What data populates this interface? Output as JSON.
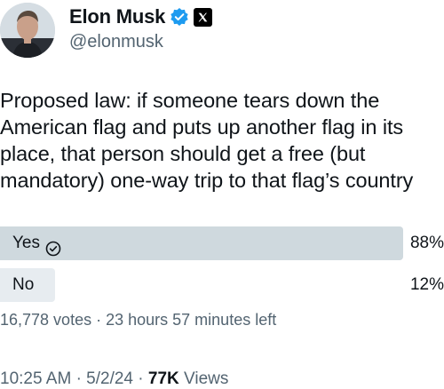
{
  "author": {
    "display_name": "Elon Musk",
    "handle": "@elonmusk",
    "verified_icon": "verified-badge-icon",
    "affiliate_icon": "x-logo-icon",
    "verified_color": "#1d9bf0"
  },
  "tweet": {
    "text": "Proposed law: if someone tears down the American flag and puts up another flag in its place, that person should get a free (but mandatory) one-way trip to that flag’s country"
  },
  "poll": {
    "options": [
      {
        "label": "Yes",
        "percent": "88%",
        "fraction": 0.88,
        "selected": true
      },
      {
        "label": "No",
        "percent": "12%",
        "fraction": 0.12,
        "selected": false
      }
    ],
    "votes": "16,778 votes",
    "separator": "·",
    "time_left": "23 hours 57 minutes left"
  },
  "meta": {
    "time": "10:25 AM",
    "separator": "·",
    "date": "5/2/24",
    "views_count": "77K",
    "views_label": "Views"
  },
  "colors": {
    "text_primary": "#0f1419",
    "text_secondary": "#536471",
    "poll_bar_winner": "#cfd9de",
    "poll_bar_other": "#e7ecf0"
  }
}
